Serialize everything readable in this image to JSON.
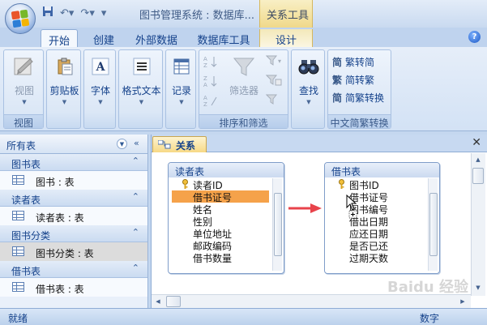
{
  "window": {
    "title": "图书管理系统 : 数据库...",
    "context_title": "关系工具"
  },
  "tabs": [
    {
      "label": "开始",
      "active": true
    },
    {
      "label": "创建"
    },
    {
      "label": "外部数据"
    },
    {
      "label": "数据库工具"
    },
    {
      "label": "设计",
      "contextual": true
    }
  ],
  "ribbon": {
    "view": {
      "button": "视图",
      "group": "视图"
    },
    "clipboard": {
      "button": "剪贴板"
    },
    "font": {
      "button": "字体"
    },
    "format": {
      "button": "格式文本"
    },
    "records": {
      "button": "记录"
    },
    "sort_filter": {
      "filter_button": "筛选器",
      "group": "排序和筛选"
    },
    "find": {
      "button": "查找"
    },
    "chinese": {
      "items": [
        "繁转简",
        "简转繁",
        "简繁转换"
      ],
      "group": "中文简繁转换"
    }
  },
  "nav": {
    "header": "所有表",
    "groups": [
      {
        "title": "图书表",
        "items": [
          {
            "label": "图书 : 表"
          }
        ]
      },
      {
        "title": "读者表",
        "items": [
          {
            "label": "读者表 : 表"
          }
        ]
      },
      {
        "title": "图书分类",
        "items": [
          {
            "label": "图书分类 : 表",
            "selected": true
          }
        ]
      },
      {
        "title": "借书表",
        "items": [
          {
            "label": "借书表 : 表"
          }
        ]
      }
    ]
  },
  "document": {
    "tab": "关系",
    "tables": [
      {
        "title": "读者表",
        "fields": [
          "读者ID",
          "借书证号",
          "姓名",
          "性别",
          "单位地址",
          "邮政编码",
          "借书数量"
        ],
        "key_field": 0,
        "selected_field": 1
      },
      {
        "title": "借书表",
        "fields": [
          "图书ID",
          "借书证号",
          "图书编号",
          "借出日期",
          "应还日期",
          "是否已还",
          "过期天数"
        ],
        "key_field": 0
      }
    ]
  },
  "status": {
    "left": "就绪",
    "right": "数字"
  },
  "watermark": "Baidu 经验",
  "colors": {
    "selection": "#f5a24a",
    "arrow": "#e8434b",
    "accent": "#15428b"
  }
}
